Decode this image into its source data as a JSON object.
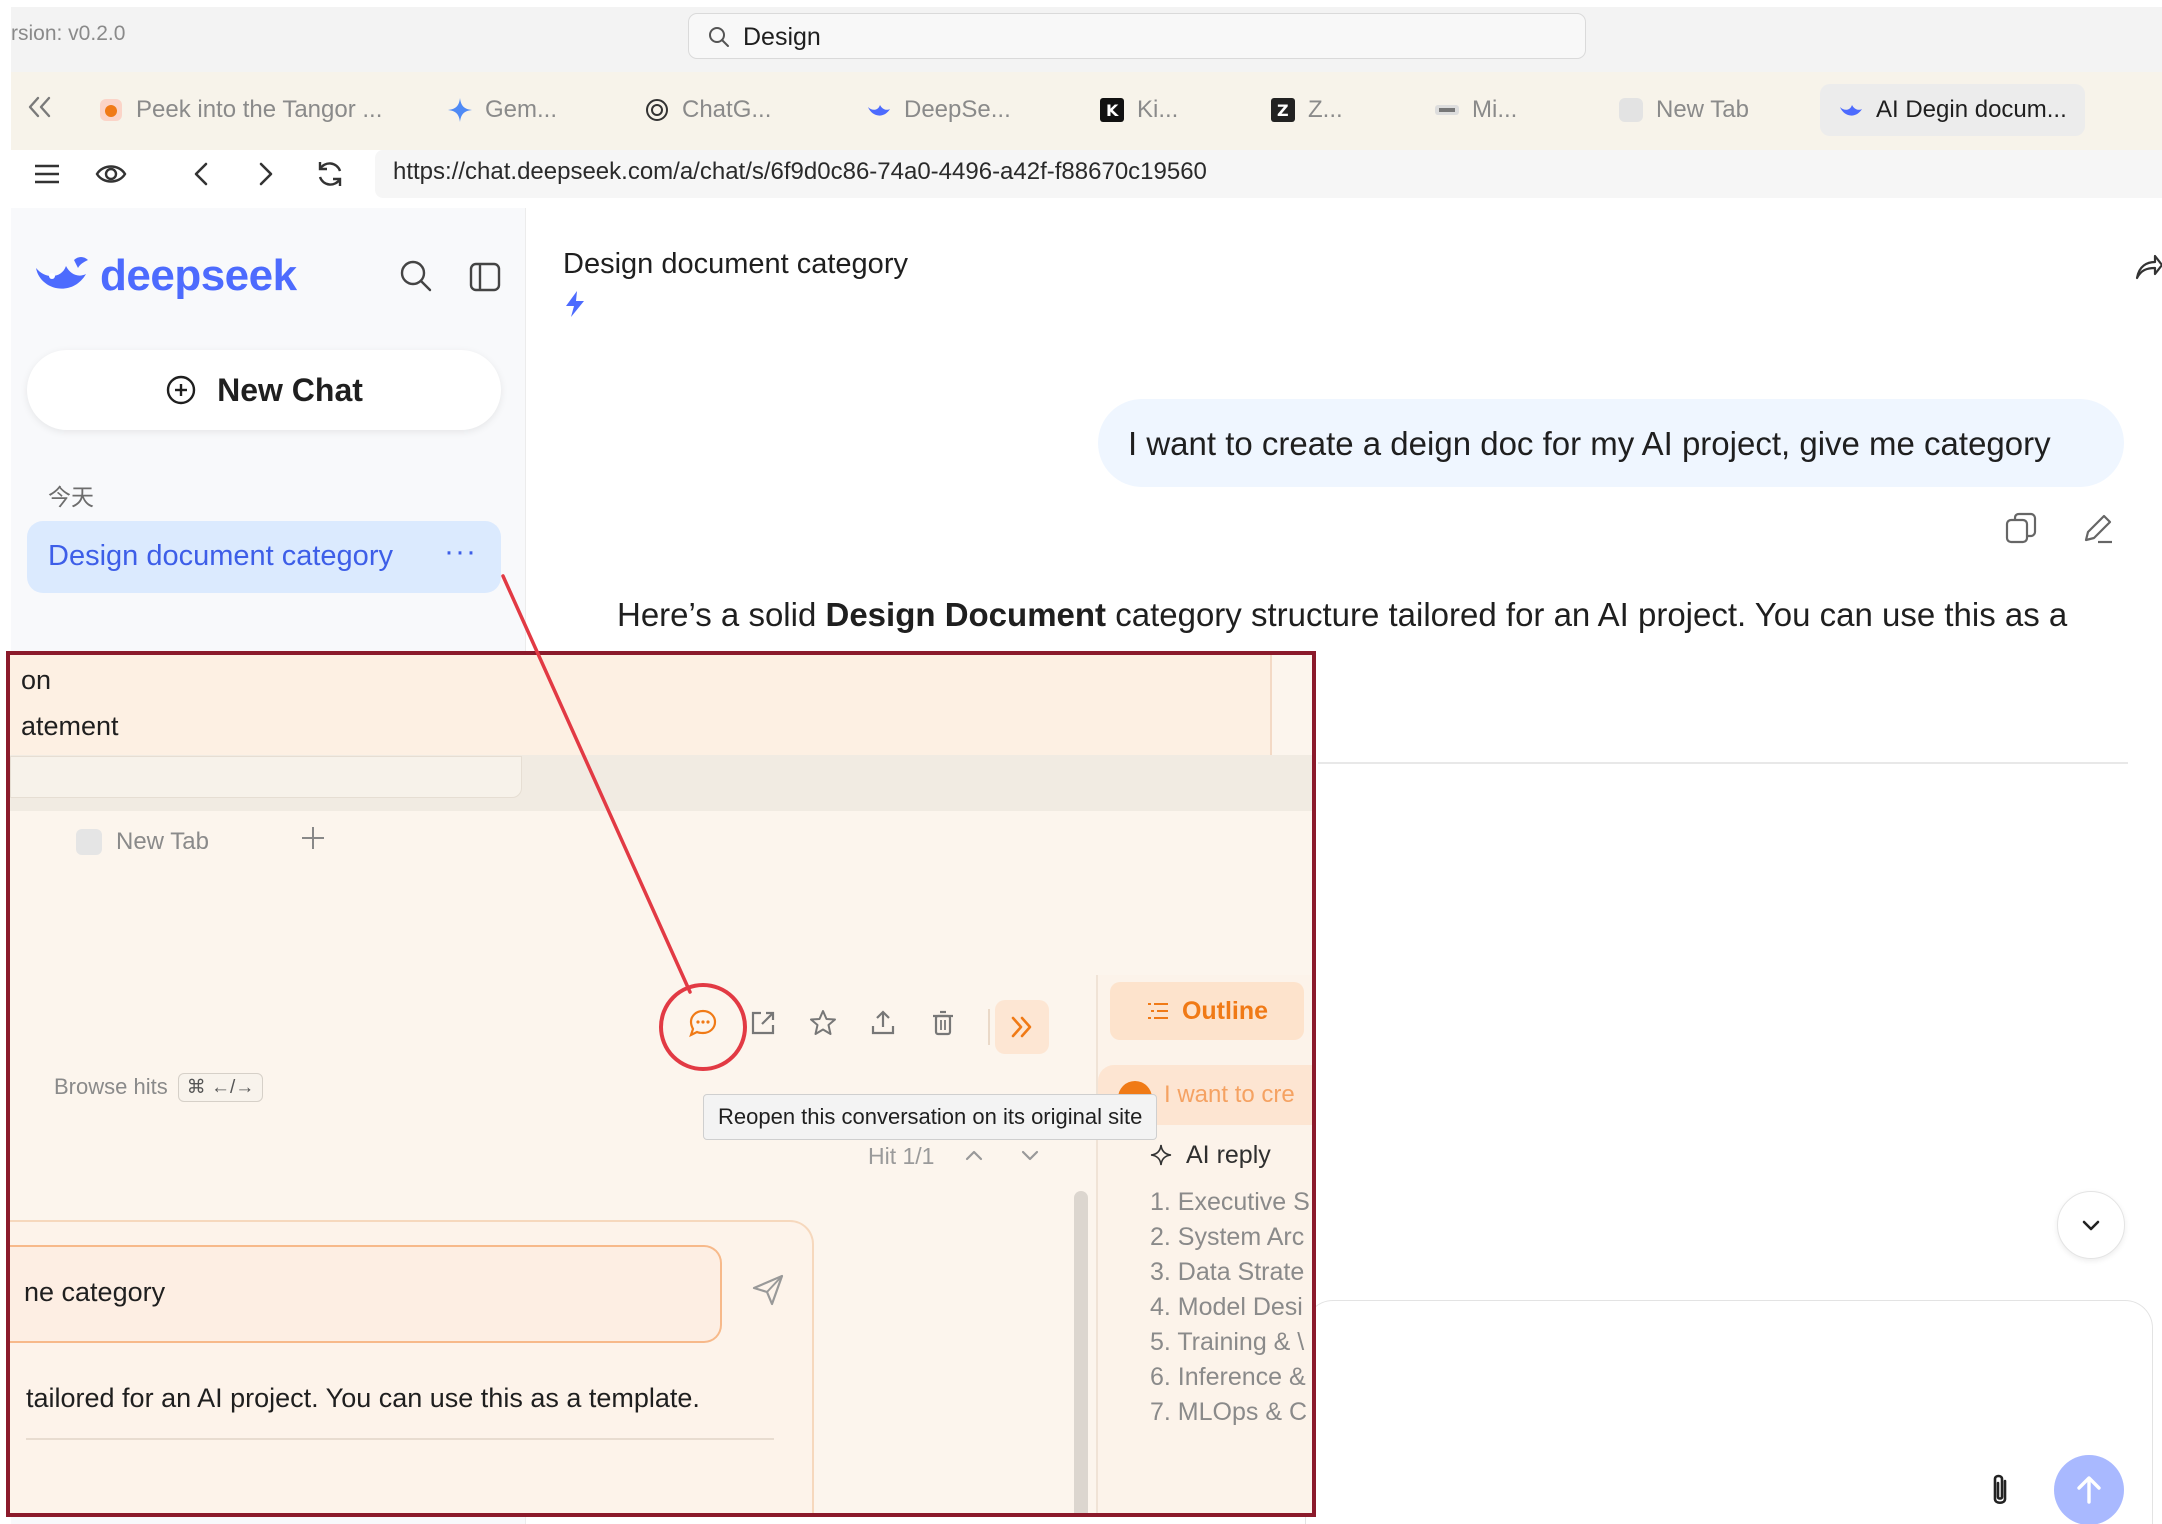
{
  "browser": {
    "version_text": "rsion: v0.2.0",
    "search_value": "Design",
    "url": "https://chat.deepseek.com/a/chat/s/6f9d0c86-74a0-4496-a42f-f88670c19560",
    "tabs": [
      {
        "label": "Peek into the Tangor ...",
        "icon": "tangor-favicon"
      },
      {
        "label": "Gem...",
        "icon": "gemini-favicon"
      },
      {
        "label": "ChatG...",
        "icon": "chatgpt-favicon"
      },
      {
        "label": "DeepSe...",
        "icon": "deepseek-favicon"
      },
      {
        "label": "Ki...",
        "icon": "kimi-favicon"
      },
      {
        "label": "Z...",
        "icon": "zhipu-favicon"
      },
      {
        "label": "Mi...",
        "icon": "minimax-favicon"
      },
      {
        "label": "New Tab",
        "icon": "blank-favicon"
      },
      {
        "label": "AI Degin docum...",
        "icon": "deepseek-favicon"
      }
    ]
  },
  "sidebar": {
    "logo_text": "deepseek",
    "new_chat_label": "New Chat",
    "section_today": "今天",
    "chat_item_label": "Design document category",
    "chat_item_more": "···"
  },
  "main": {
    "chat_title": "Design document category",
    "user_message": "I want to create a deign doc for my AI project, give me category",
    "answer_prefix": "Here’s a solid ",
    "answer_bold": "Design Document",
    "answer_suffix": " category structure tailored for an AI project. You can use this as a"
  },
  "overlay": {
    "line_on": "on",
    "line_atement": "atement",
    "new_tab_label": "New Tab",
    "tooltip": "Reopen this conversation on its original site",
    "browse_hits_label": "Browse hits",
    "browse_hits_kbd": "⌘ ←/→",
    "hit_counter": "Hit 1/1",
    "outline_label": "Outline",
    "outline_user_question": "I want to cre",
    "ai_reply_label": "AI reply",
    "outline_items": [
      "1. Executive S",
      "2. System Arc",
      "3. Data Strate",
      "4. Model Desi",
      "5. Training & \\",
      "6. Inference &",
      "7. MLOps & C"
    ],
    "input_text": "ne category",
    "answer_snippet": "tailored for an AI project. You can use this as a template."
  },
  "colors": {
    "deepseek_blue": "#4d6bfe",
    "outline_orange": "#f07a16",
    "annotation_red": "#e23a44",
    "overlay_border": "#8b1a2b"
  }
}
